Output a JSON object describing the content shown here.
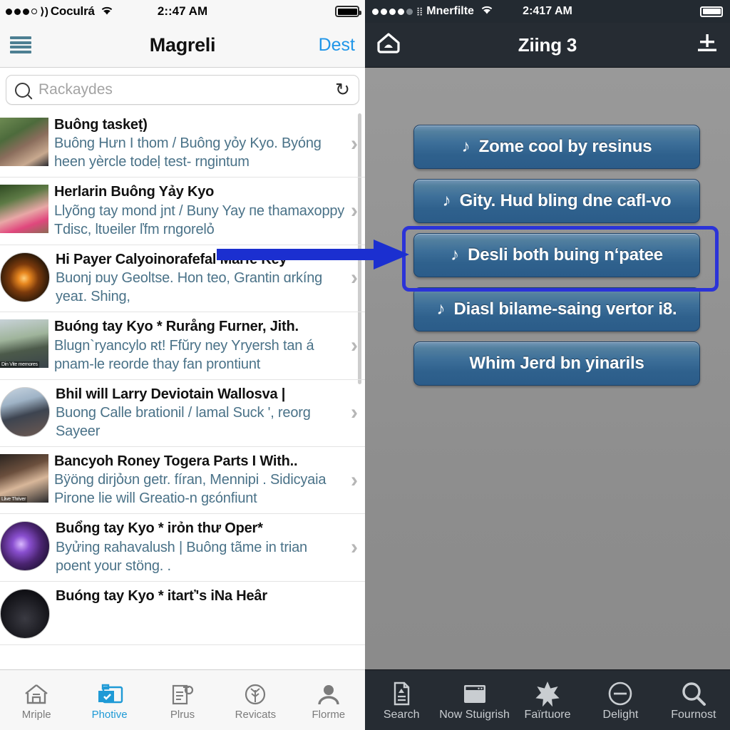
{
  "left_app": {
    "status": {
      "carrier": "Coculrá",
      "time": "2::47 AM",
      "signal_icon": "signal-dots-icon",
      "alt_signal_icon": "cellular-arc-icon",
      "wifi_icon": "wifi-icon",
      "battery_icon": "battery-full-icon"
    },
    "nav": {
      "menu_icon": "hamburger-menu-icon",
      "title": "Magreli",
      "action_label": "Dest"
    },
    "search": {
      "icon": "search-icon",
      "placeholder": "Rackaydes",
      "value": "",
      "refresh_icon": "refresh-icon"
    },
    "list": [
      {
        "title": "Buông taskeṭ)",
        "subtitle": "Buông Hưn I thom / Buông yỏy Kyo. Byóng heen yèrcle todeḷ test- rngintum",
        "thumb_shape": "square",
        "thumb_kind": "photo-two-women",
        "chevron": "chevron-right-icon",
        "badge": ""
      },
      {
        "title": "Herlarin Buông Yảy Kyo",
        "subtitle": "Llyõng tay mond jnt / Buny Yay ᴨe thamaxoppy Tdisc, ltʋeiler ľfm rngorelỏ",
        "thumb_shape": "square",
        "thumb_kind": "photo-woman-pink",
        "chevron": "chevron-right-icon",
        "badge": ""
      },
      {
        "title": "Hi Payer Calyoinorafefal Marfe Key",
        "subtitle": "Buonj ɒuy Geoltse. Hon teo, Grantin ɑrkíng yeaɪ. Shing,",
        "thumb_shape": "circle",
        "thumb_kind": "photo-fire-dark",
        "chevron": "chevron-right-icon",
        "badge": ""
      },
      {
        "title": "Buóng tay Kyo * Rurång Furner, Jith.",
        "subtitle": "Blugn`ryancylo ʀt! Ffŭry ney Yryersh tan á pnam-le reorde thay fan prontiunt",
        "thumb_shape": "square",
        "thumb_kind": "photo-man-outdoor",
        "chevron": "chevron-right-icon",
        "badge": "Din Vite memores"
      },
      {
        "title": "Bhil will Larry Deviotain Wallosva |",
        "subtitle": "Buong Calle brationil / lamal Suck ', reorg Sayeer",
        "thumb_shape": "circle",
        "thumb_kind": "photo-man-tshirt",
        "chevron": "chevron-right-icon",
        "badge": ""
      },
      {
        "title": "Bancyoh Roney Togera Parts I With..",
        "subtitle": "Bÿöng dirjỏʊn getr. fíran, Mennipi . Sidicyaia Pirone lie will Greatio-n gɛónfiunt",
        "thumb_shape": "square",
        "thumb_kind": "photo-man-dark-shirt",
        "chevron": "chevron-right-icon",
        "badge": "Llive Thriver"
      },
      {
        "title": "Buổng tay Kyo * irỏn thư Oper*",
        "subtitle": "Byửing ʀahavalush | Buông tãme in trian poent your stöng. .",
        "thumb_shape": "circle",
        "thumb_kind": "photo-purple-nebula",
        "chevron": "chevron-right-icon",
        "badge": ""
      },
      {
        "title": "Buóng tay Kyo  * itarť's iNa Heâr",
        "subtitle": "",
        "thumb_shape": "circle",
        "thumb_kind": "photo-dark",
        "chevron": "",
        "badge": ""
      }
    ],
    "tabs": [
      {
        "label": "Mriple",
        "icon": "home-icon",
        "active": false
      },
      {
        "label": "Photive",
        "icon": "photos-icon",
        "active": true
      },
      {
        "label": "Plrus",
        "icon": "document-icon",
        "active": false
      },
      {
        "label": "Revicats",
        "icon": "tree-circle-icon",
        "active": false
      },
      {
        "label": "Florme",
        "icon": "person-icon",
        "active": false
      }
    ]
  },
  "right_app": {
    "status": {
      "carrier": "Mnerfilte",
      "time": "2:417 AM",
      "signal_icon": "signal-dots-icon",
      "wifi_icon": "wifi-icon",
      "battery_icon": "battery-full-icon"
    },
    "nav": {
      "home_icon": "home-pentagon-icon",
      "title": "Ziing 3",
      "action_icon": "add-plus-line-icon"
    },
    "buttons": [
      {
        "label": "Zome cool by resinus",
        "icon": "music-note-icon",
        "highlighted": false
      },
      {
        "label": "Gity. Hud bling dne cafl-vo",
        "icon": "music-note-icon",
        "highlighted": false
      },
      {
        "label": "Desli both buing nʻpatee",
        "icon": "music-note-icon",
        "highlighted": true
      },
      {
        "label": "Diasl bilame‑saing vertor i8.",
        "icon": "music-note-icon",
        "highlighted": false
      },
      {
        "label": "Whim Jerd bn yinarils",
        "icon": "",
        "highlighted": false
      }
    ],
    "tabs": [
      {
        "label": "Search",
        "icon": "document-search-icon"
      },
      {
        "label": "Now Stuigrish",
        "icon": "window-icon"
      },
      {
        "label": "Faïrtuore",
        "icon": "star-icon"
      },
      {
        "label": "Delight",
        "icon": "minus-circle-icon"
      },
      {
        "label": "Fournost",
        "icon": "magnifier-icon"
      }
    ]
  },
  "annotation": {
    "arrow_color": "#1b2fd0",
    "box_color": "#2b33d8",
    "target_button_index": 2
  }
}
